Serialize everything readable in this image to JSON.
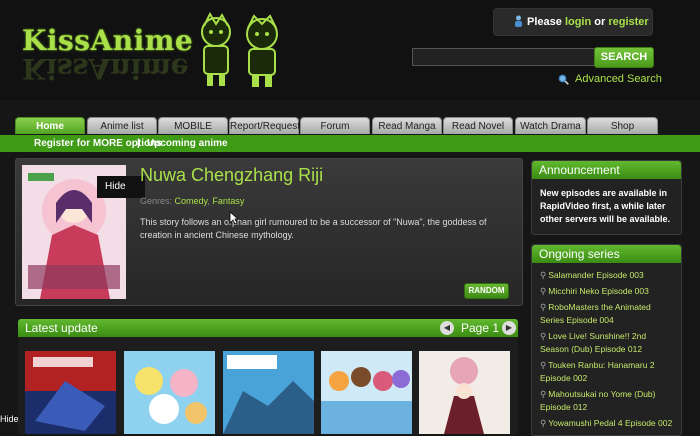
{
  "header": {
    "logo": "KissAnime",
    "login": {
      "prefix": "Please",
      "login": "login",
      "or": "or",
      "register": "register"
    },
    "search": {
      "value": "",
      "button": "SEARCH",
      "advanced": "Advanced Search"
    }
  },
  "nav": {
    "tabs": [
      "Home",
      "Anime list",
      "MOBILE",
      "Report/Request",
      "Forum",
      "Read Manga",
      "Read Novel",
      "Watch Drama",
      "Shop"
    ],
    "subnav": [
      "Register for MORE options",
      "|",
      "Upcoming anime"
    ]
  },
  "featured": {
    "hide": "Hide",
    "title": "Nuwa Chengzhang Riji",
    "genres_label": "Genres:",
    "genres": [
      "Comedy",
      "Fantasy"
    ],
    "description": "This story follows an orphan girl rumoured to be a successor of \"Nuwa\", the goddess of creation in ancient Chinese mythology.",
    "random": "RANDOM"
  },
  "latest": {
    "label": "Latest update",
    "page_label": "Page 1"
  },
  "announcement": {
    "title": "Announcement",
    "text": "New episodes are available in RapidVideo first, a while later other servers will be available."
  },
  "ongoing": {
    "title": "Ongoing series",
    "items": [
      "Salamander Episode 003",
      "Micchiri Neko Episode 003",
      "RoboMasters the Animated Series Episode 004",
      "Love Live! Sunshine!! 2nd Season (Dub) Episode 012",
      "Touken Ranbu: Hanamaru 2 Episode 002",
      "Mahoutsukai no Yome (Dub) Episode 012",
      "Yowamushi Pedal 4 Episode 002"
    ]
  },
  "footer": {
    "hide": "Hide"
  },
  "colors": {
    "accent": "#a9e04a",
    "nav_green": "#3f9a16",
    "background": "#161616"
  }
}
